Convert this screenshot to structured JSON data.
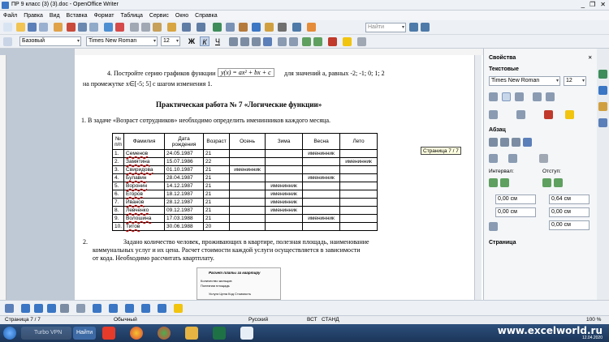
{
  "window": {
    "title": "ПР 9 класс  (3) (3).doc - OpenOffice Writer",
    "controls": [
      "_",
      "❐",
      "✕"
    ]
  },
  "menu": [
    "Файл",
    "Правка",
    "Вид",
    "Вставка",
    "Формат",
    "Таблица",
    "Сервис",
    "Окно",
    "Справка"
  ],
  "toolbar": {
    "search_placeholder": "Найти"
  },
  "format": {
    "style": "Базовый",
    "font": "Times New Roman",
    "size": "12",
    "bold": "Ж",
    "italic": "К",
    "underline": "Ч"
  },
  "document": {
    "line1": "4. Постройте серию графиков функции",
    "formula": "y(x) = ax² + bx + c",
    "line1b": "для значений а, равных   -2; -1; 0; 1; 2",
    "line2": "на промежутке х∈[-5; 5] с шагом изменения 1.",
    "heading": "Практическая работа № 7 «Логические функции»",
    "task1": "1.   В задаче «Возраст сотрудников» необходимо определить именинников каждого месяца.",
    "table": {
      "headers": [
        "№ п/п",
        "Фамилия",
        "Дата рождения",
        "Возраст",
        "Осень",
        "Зима",
        "Весна",
        "Лето"
      ],
      "rows": [
        [
          "1.",
          "Семенов",
          "24.05.1987",
          "21",
          "",
          "",
          "именинник",
          ""
        ],
        [
          "2.",
          "Замятина",
          "15.07.1986",
          "22",
          "",
          "",
          "",
          "именинник"
        ],
        [
          "3.",
          "Свиридова",
          "01.10.1987",
          "21",
          "именинник",
          "",
          "",
          ""
        ],
        [
          "4.",
          "Булавин",
          "28.04.1987",
          "21",
          "",
          "",
          "именинник",
          ""
        ],
        [
          "5.",
          "Воронин",
          "14.12.1987",
          "21",
          "",
          "именинник",
          "",
          ""
        ],
        [
          "6.",
          "Егоров",
          "18.12.1987",
          "21",
          "",
          "именинник",
          "",
          ""
        ],
        [
          "7.",
          "Иванов",
          "28.12.1987",
          "21",
          "",
          "именинник",
          "",
          ""
        ],
        [
          "8.",
          "Левченко",
          "09.12.1987",
          "21",
          "",
          "именинник",
          "",
          ""
        ],
        [
          "9.",
          "Волошина",
          "17.03.1988",
          "21",
          "",
          "",
          "именинник",
          ""
        ],
        [
          "10.",
          "Титов",
          "30.06.1988",
          "20",
          "",
          "",
          "",
          ""
        ]
      ]
    },
    "task2_num": "2.",
    "task2_l1": "Задано количество человек, проживающих в квартире, полезная площадь, наименование",
    "task2_l2": "коммунальных услуг и их цена. Расчет стоимости каждой услуги осуществляется в зависимости",
    "task2_l3": "от кода. Необходимо рассчитать квартплату.",
    "embedded_title": "Расчет платы за квартиру",
    "embedded_l1": "Количество жильцов",
    "embedded_l2": "Полезная площадь",
    "embedded_cols": "Услуги    Цена  Код  Стоимость",
    "tooltip": "Страница 7 / 7"
  },
  "sidebar": {
    "title": "Свойства",
    "text_section": "Текстовые",
    "font": "Times New Roman",
    "size": "12",
    "para_section": "Абзац",
    "interval_label": "Интервал:",
    "indent_label": "Отступ:",
    "spin": [
      "0,00 см",
      "0,00 см",
      "0,64 см",
      "0,00 см",
      "0,00 см"
    ],
    "page_section": "Страница"
  },
  "status": {
    "page": "Страница 7 / 7",
    "style": "Обычный",
    "lang": "Русский",
    "mode1": "ВСТ",
    "mode2": "СТАНД",
    "zoom": "100 %"
  },
  "taskbar": {
    "vpn": "Turbo VPN",
    "search_btn": "Найти",
    "watermark": "www.excelworld.ru",
    "time": "12.04.2020"
  },
  "colors": {
    "accent": "#3a76c4",
    "underline_red": "#cc0000"
  }
}
